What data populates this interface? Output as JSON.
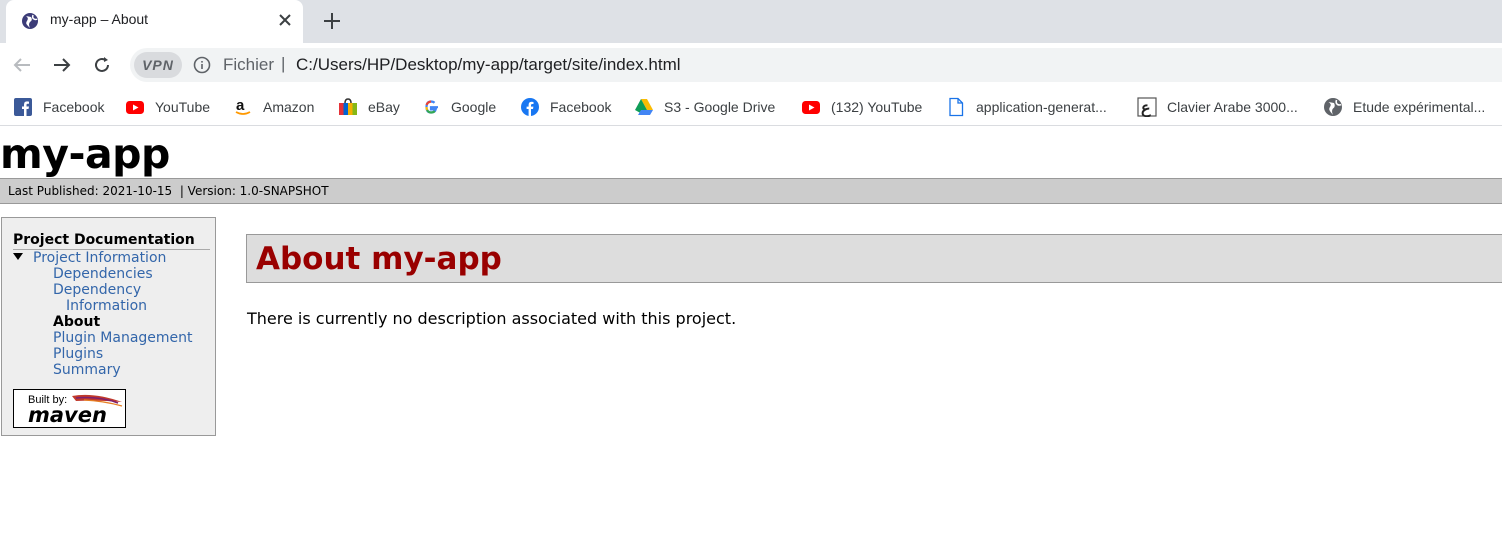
{
  "browser": {
    "tab_title": "my-app – About",
    "vpn_label": "VPN",
    "scheme_label": "Fichier",
    "url_separator": "|",
    "url": "C:/Users/HP/Desktop/my-app/target/site/index.html"
  },
  "bookmarks": [
    {
      "label": "Facebook",
      "icon": "facebook-square-icon"
    },
    {
      "label": "YouTube",
      "icon": "youtube-icon"
    },
    {
      "label": "Amazon",
      "icon": "amazon-icon"
    },
    {
      "label": "eBay",
      "icon": "ebay-icon"
    },
    {
      "label": "Google",
      "icon": "google-icon"
    },
    {
      "label": "Facebook",
      "icon": "facebook-circle-icon"
    },
    {
      "label": "S3 - Google Drive",
      "icon": "google-drive-icon"
    },
    {
      "label": "(132) YouTube",
      "icon": "youtube-icon"
    },
    {
      "label": "application-generat...",
      "icon": "document-icon"
    },
    {
      "label": "Clavier Arabe 3000...",
      "icon": "clavier-icon"
    },
    {
      "label": "Etude expérimental...",
      "icon": "globe-icon"
    }
  ],
  "site": {
    "title": "my-app",
    "last_published": "Last Published: 2021-10-15",
    "version": "| Version: 1.0-SNAPSHOT"
  },
  "nav": {
    "heading": "Project Documentation",
    "section": "Project Information",
    "items": [
      "Dependencies",
      "Dependency",
      "Information",
      "About",
      "Plugin Management",
      "Plugins",
      "Summary"
    ],
    "badge_built_by": "Built by:",
    "badge_maven": "maven"
  },
  "content": {
    "heading": "About my-app",
    "text": "There is currently no description associated with this project."
  },
  "colors": {
    "link": "#3366aa",
    "heading": "#990000",
    "breadcrumb_bg": "#cccccc"
  }
}
